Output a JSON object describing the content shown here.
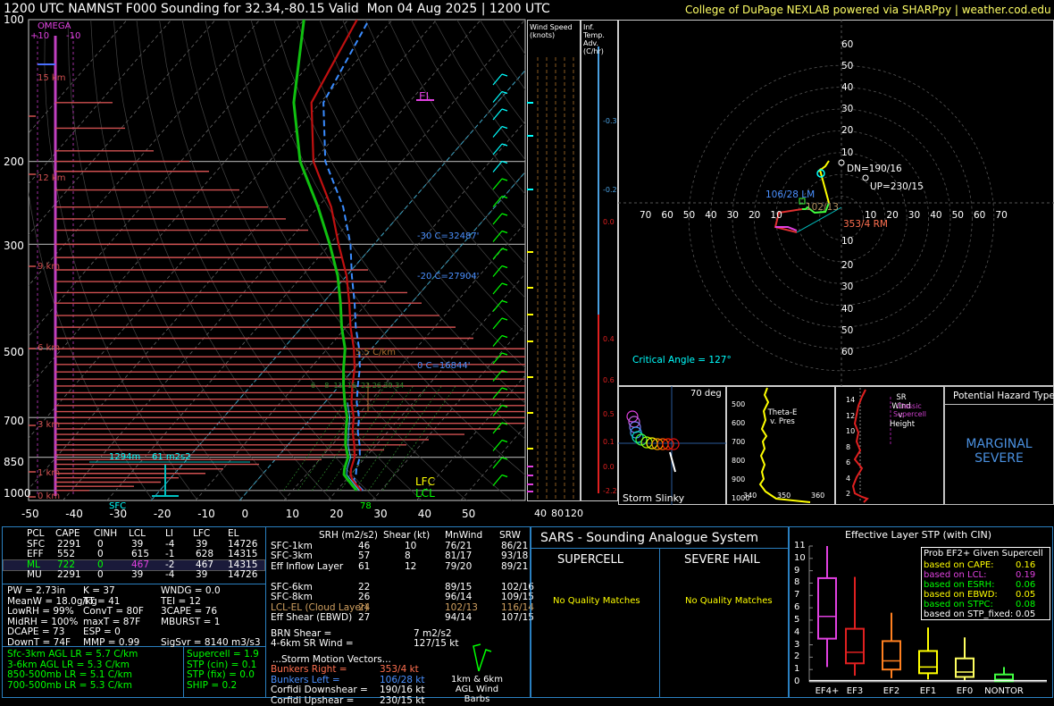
{
  "header": {
    "title": "1200 UTC NAMNST F000 Sounding for 32.34,-80.15 Valid  Mon 04 Aug 2025 | 1200 UTC",
    "credit": "College of DuPage NEXLAB powered via SHARPpy | weather.cod.edu"
  },
  "skewt": {
    "pressure_labels": [
      "100",
      "200",
      "300",
      "500",
      "700",
      "850",
      "1000"
    ],
    "temp_labels": [
      "-50",
      "-40",
      "-30",
      "-20",
      "-10",
      "0",
      "10",
      "20",
      "30",
      "40",
      "50"
    ],
    "height_labels": [
      "15 km",
      "12 km",
      "9 km",
      "6 km",
      "3 km",
      "1 km",
      "0 km"
    ],
    "omega_title": "OMEGA",
    "omega_plus": "+10",
    "omega_minus": "-10",
    "el_label": "EL",
    "lfc_label": "LFC",
    "lcl_label": "LCL",
    "sfc_label": "SFC",
    "sfc_temp": "78",
    "iso30": "-30 C=32487'",
    "iso20": "-20 C=27904'",
    "iso0": "0 C=16844'",
    "lapse_label": "5.5 C/km",
    "dcape_label": "1294m",
    "effsrh_label": "61 m2s2",
    "mixing_ratios": "6    8  11  16  22 26 30 34"
  },
  "wind_speed_panel": {
    "title": "Wind Speed (knots)",
    "labels": [
      "40",
      "80",
      "120"
    ]
  },
  "inferred_temp_panel": {
    "title": "Inf. Temp. Adv. (C/hr)",
    "labels": [
      "-0.3",
      "-0.2",
      "0.0",
      "0.4",
      "0.6",
      "0.5",
      "0.1",
      "0.0",
      "-2.2"
    ]
  },
  "hodograph": {
    "ring_labels": [
      "60",
      "50",
      "40",
      "30",
      "20",
      "10"
    ],
    "axis_labels_left": [
      "70",
      "60",
      "50",
      "40",
      "30",
      "20",
      "10"
    ],
    "axis_labels_right": [
      "10",
      "20",
      "30",
      "40",
      "50",
      "60",
      "70"
    ],
    "dn_label": "DN=190/16",
    "up_label": "UP=230/15",
    "lm_label": "106/28 LM",
    "rm_label": "353/4 RM",
    "mean_label": "102/13",
    "critical_angle": "Critical Angle = 127°"
  },
  "storm_slinky": {
    "title": "Storm Slinky",
    "deg": "70 deg"
  },
  "thetae_panel": {
    "title": "Theta-E v. Pres",
    "pres_labels": [
      "500",
      "600",
      "700",
      "800",
      "900",
      "1000"
    ],
    "x_labels": [
      "340",
      "350",
      "360"
    ]
  },
  "srwind_panel": {
    "title": "SR Wind v. Height",
    "classic": "Classic Supercell",
    "height_labels": [
      "14",
      "12",
      "10",
      "8",
      "6",
      "4",
      "2"
    ]
  },
  "hazard": {
    "title": "Potential Hazard Type",
    "value": "MARGINAL SEVERE"
  },
  "parcels": {
    "headers": [
      "PCL",
      "CAPE",
      "CINH",
      "LCL",
      "LI",
      "LFC",
      "EL"
    ],
    "rows": [
      [
        "SFC",
        "2291",
        "0",
        "39",
        "-4",
        "39",
        "14726"
      ],
      [
        "EFF",
        "552",
        "0",
        "615",
        "-1",
        "628",
        "14315"
      ],
      [
        "ML",
        "722",
        "0",
        "467",
        "-2",
        "467",
        "14315"
      ],
      [
        "MU",
        "2291",
        "0",
        "39",
        "-4",
        "39",
        "14726"
      ]
    ]
  },
  "indices": [
    [
      "PW = 2.73in",
      "K = 37",
      "WNDG = 0.0"
    ],
    [
      "MeanW = 18.0g/kg",
      "TT = 41",
      "TEI = 12"
    ],
    [
      "LowRH = 99%",
      "ConvT = 80F",
      "3CAPE = 76"
    ],
    [
      "MidRH = 100%",
      "maxT = 87F",
      "MBURST = 1"
    ],
    [
      "DCAPE = 73",
      "ESP = 0",
      ""
    ],
    [
      "DownT = 74F",
      "MMP = 0.99",
      "SigSvr = 8140 m3/s3"
    ]
  ],
  "lapse_rates": [
    "Sfc-3km AGL LR = 5.7 C/km",
    "3-6km AGL LR = 5.3 C/km",
    "850-500mb LR = 5.1 C/km",
    "700-500mb LR = 5.3 C/km"
  ],
  "composites": [
    "Supercell = 1.9",
    "STP (cin) = 0.1",
    "STP (fix) = 0.0",
    "SHIP = 0.2"
  ],
  "kinematics": {
    "headers": [
      "SRH (m2/s2)",
      "Shear (kt)",
      "MnWind",
      "SRW"
    ],
    "rows": [
      [
        "SFC-1km",
        "46",
        "10",
        "76/21",
        "86/21"
      ],
      [
        "SFC-3km",
        "57",
        "8",
        "81/17",
        "93/18"
      ],
      [
        "Eff Inflow Layer",
        "61",
        "12",
        "79/20",
        "89/21"
      ],
      [
        "",
        "",
        "",
        "",
        ""
      ],
      [
        "SFC-6km",
        "22",
        "",
        "89/15",
        "102/16"
      ],
      [
        "SFC-8km",
        "26",
        "",
        "96/14",
        "109/15"
      ],
      [
        "LCL-EL (Cloud Layer)",
        "24",
        "",
        "102/13",
        "116/14"
      ],
      [
        "Eff Shear (EBWD)",
        "27",
        "",
        "94/14",
        "107/15"
      ]
    ],
    "brn": "BRN Shear =",
    "brn_val": "7 m2/s2",
    "srw46": "4-6km SR Wind =",
    "srw46_val": "127/15 kt",
    "vectors_title": "...Storm Motion Vectors...",
    "vectors": [
      [
        "Bunkers Right =",
        "353/4 kt"
      ],
      [
        "Bunkers Left =",
        "106/28 kt"
      ],
      [
        "Corfidi Downshear =",
        "190/16 kt"
      ],
      [
        "Corfidi Upshear =",
        "230/15 kt"
      ]
    ],
    "barb_caption": "1km & 6km AGL Wind Barbs"
  },
  "sars": {
    "title": "SARS - Sounding Analogue System",
    "supercell": "SUPERCELL",
    "hail": "SEVERE HAIL",
    "none1": "No Quality Matches",
    "none2": "No Quality Matches"
  },
  "stp": {
    "title": "Effective Layer STP (with CIN)",
    "prob_title": "Prob EF2+ Given Supercell",
    "probs": [
      [
        "based on CAPE:",
        "0.16"
      ],
      [
        "based on LCL:",
        "0.19"
      ],
      [
        "based on ESRH:",
        "0.06"
      ],
      [
        "based on EBWD:",
        "0.05"
      ],
      [
        "based on STPC:",
        "0.08"
      ],
      [
        "based on STP_fixed:",
        "0.05"
      ]
    ],
    "y_labels": [
      "11",
      "10",
      "9",
      "8",
      "7",
      "6",
      "5",
      "4",
      "3",
      "2",
      "1",
      "0"
    ]
  },
  "chart_data": {
    "type": "line",
    "title": "1200 UTC NAMNST F000 Sounding for 32.34,-80.15",
    "skewt_temperature": {
      "pressure_mb": [
        1000,
        975,
        950,
        925,
        900,
        850,
        800,
        750,
        700,
        650,
        600,
        550,
        500,
        450,
        400,
        350,
        300,
        250,
        200,
        150,
        100
      ],
      "temperature_c": [
        25.6,
        23.5,
        21.5,
        20.0,
        19.0,
        17.5,
        15.0,
        12.0,
        9.5,
        6.0,
        3.0,
        0.0,
        -4.0,
        -9.0,
        -14.0,
        -20.0,
        -28.0,
        -37.0,
        -50.0,
        -62.0,
        -68.0
      ],
      "dewpoint_c": [
        24.5,
        22.5,
        20.5,
        18.5,
        17.5,
        16.0,
        13.0,
        10.5,
        8.0,
        4.5,
        1.0,
        -2.5,
        -6.0,
        -11.0,
        -16.0,
        -22.0,
        -30.0,
        -40.0,
        -53.0,
        -66.0,
        -80.0
      ]
    },
    "stp_boxplots": {
      "categories": [
        "EF4+",
        "EF3",
        "EF2",
        "EF1",
        "EF0",
        "NONTOR"
      ],
      "ylim": [
        0,
        11
      ],
      "min": [
        1.2,
        0.5,
        0.3,
        0.2,
        0.1,
        0.0
      ],
      "q1": [
        3.5,
        1.5,
        1.0,
        0.7,
        0.4,
        0.05
      ],
      "median": [
        5.3,
        2.4,
        1.7,
        1.2,
        0.8,
        0.2
      ],
      "q3": [
        8.4,
        4.3,
        3.3,
        2.5,
        1.9,
        0.6
      ],
      "max": [
        11.0,
        8.5,
        5.6,
        4.4,
        3.6,
        1.2
      ]
    }
  }
}
